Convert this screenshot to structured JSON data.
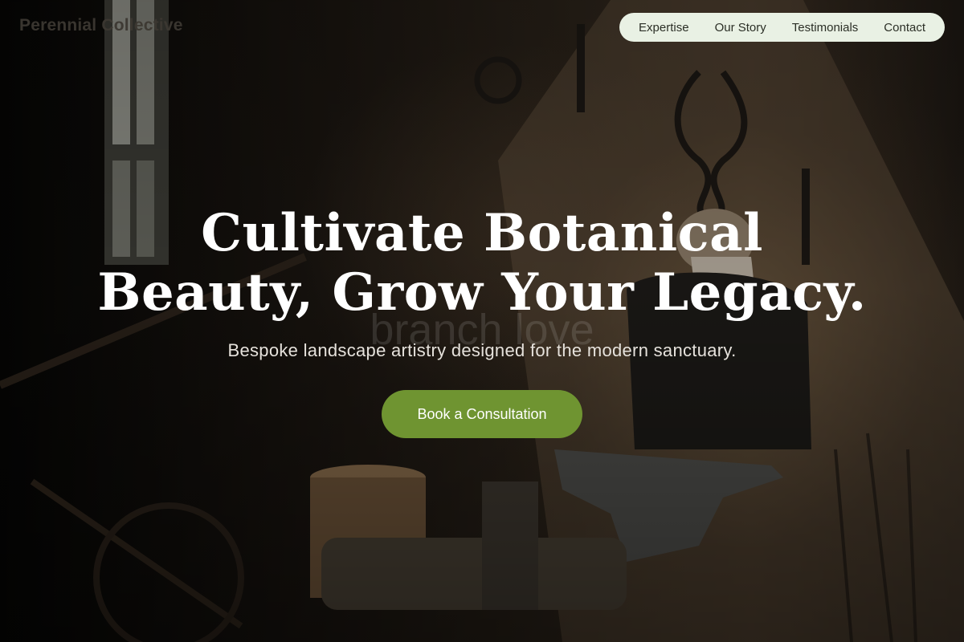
{
  "brand": {
    "name": "Perennial Collective"
  },
  "nav": {
    "items": [
      {
        "label": "Expertise"
      },
      {
        "label": "Our Story"
      },
      {
        "label": "Testimonials"
      },
      {
        "label": "Contact"
      }
    ]
  },
  "hero": {
    "headline_line1": "Cultivate Botanical",
    "headline_line2": "Beauty, Grow Your Legacy.",
    "watermark": "branch love",
    "subtitle": "Bespoke landscape artistry designed for the modern sanctuary.",
    "cta_label": "Book a Consultation"
  },
  "colors": {
    "nav_background": "#e9f1e4",
    "cta_background": "#6f9431",
    "headline_text": "#ffffff"
  }
}
